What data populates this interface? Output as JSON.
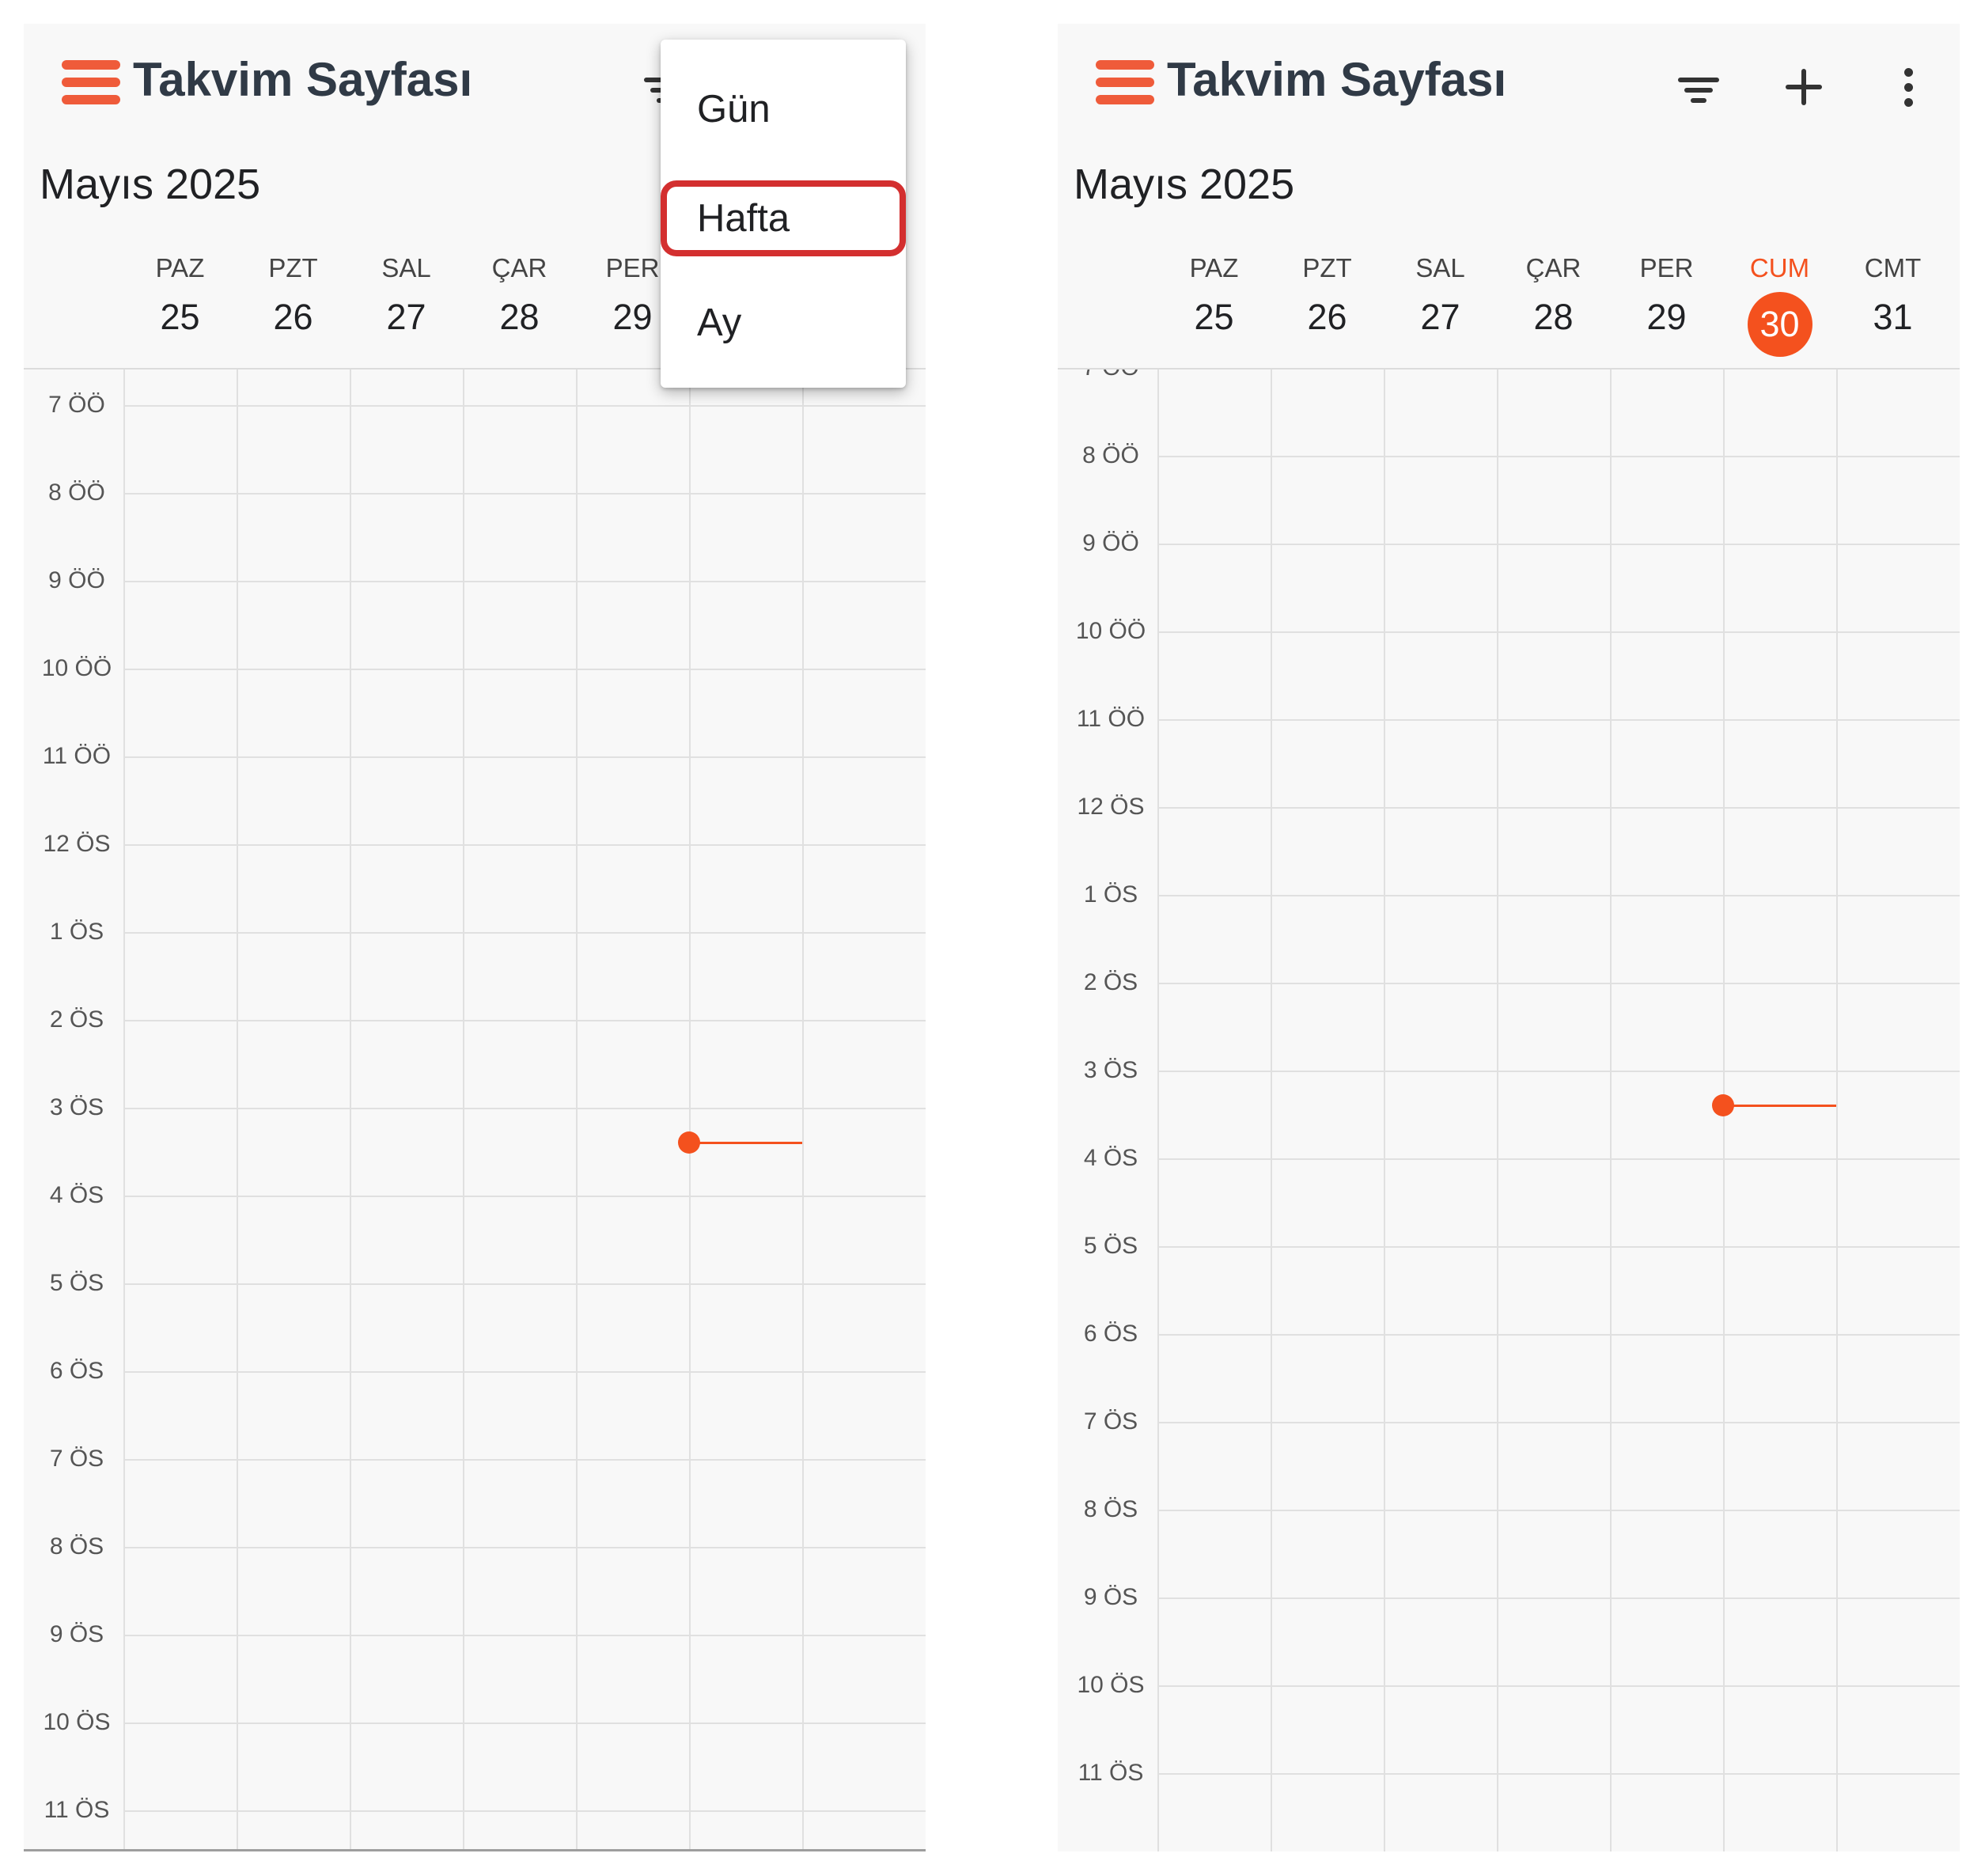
{
  "app": {
    "title": "Takvim Sayfası"
  },
  "month_title": "Mayıs 2025",
  "days": [
    {
      "name": "PAZ",
      "num": "25"
    },
    {
      "name": "PZT",
      "num": "26"
    },
    {
      "name": "SAL",
      "num": "27"
    },
    {
      "name": "ÇAR",
      "num": "28"
    },
    {
      "name": "PER",
      "num": "29"
    },
    {
      "name": "CUM",
      "num": "30"
    },
    {
      "name": "CMT",
      "num": "31"
    }
  ],
  "today_index": 5,
  "hours": [
    "7 ÖÖ",
    "8 ÖÖ",
    "9 ÖÖ",
    "10 ÖÖ",
    "11 ÖÖ",
    "12 ÖS",
    "1 ÖS",
    "2 ÖS",
    "3 ÖS",
    "4 ÖS",
    "5 ÖS",
    "6 ÖS",
    "7 ÖS",
    "8 ÖS",
    "9 ÖS",
    "10 ÖS",
    "11 ÖS"
  ],
  "view_menu": {
    "items": [
      "Gün",
      "Hafta",
      "Ay"
    ],
    "highlighted": "Hafta"
  },
  "icons": {
    "menu": "hamburger-menu-icon",
    "filter": "filter-icon",
    "add": "plus-icon",
    "more": "more-vert-icon"
  },
  "colors": {
    "accent": "#f4511e",
    "hamburger": "#ef5b3a",
    "highlight_box": "#d32f2f",
    "background": "#f8f8f8"
  },
  "current_time_label": "3:25 ÖS"
}
